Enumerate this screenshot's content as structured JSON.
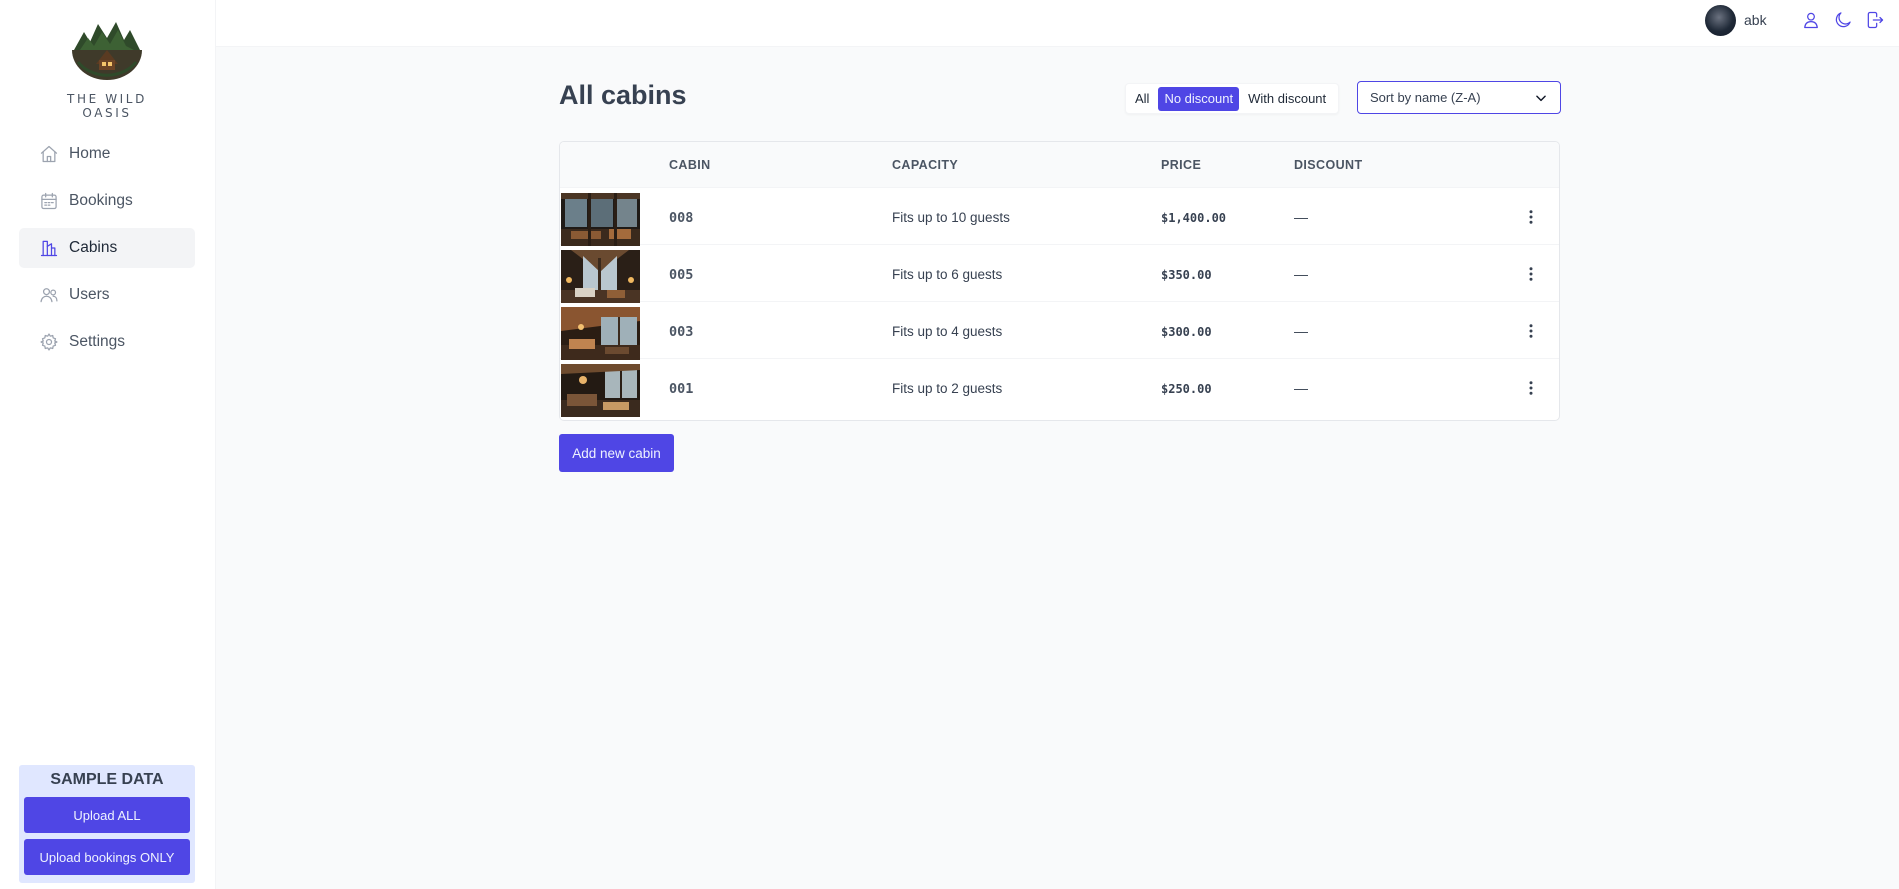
{
  "brand": {
    "name": "THE WILD OASIS"
  },
  "sidebar": {
    "items": [
      {
        "label": "Home",
        "icon": "home-icon",
        "active": false
      },
      {
        "label": "Bookings",
        "icon": "calendar-icon",
        "active": false
      },
      {
        "label": "Cabins",
        "icon": "cabins-icon",
        "active": true
      },
      {
        "label": "Users",
        "icon": "users-icon",
        "active": false
      },
      {
        "label": "Settings",
        "icon": "gear-icon",
        "active": false
      }
    ],
    "sample": {
      "title": "SAMPLE DATA",
      "upload_all": "Upload ALL",
      "upload_bookings": "Upload bookings ONLY"
    }
  },
  "header": {
    "username": "abk",
    "icons": [
      "user-icon",
      "moon-icon",
      "logout-icon"
    ]
  },
  "main": {
    "title": "All cabins",
    "filters": [
      {
        "label": "All",
        "active": false
      },
      {
        "label": "No discount",
        "active": true
      },
      {
        "label": "With discount",
        "active": false
      }
    ],
    "sort": {
      "selected": "Sort by name (Z-A)"
    },
    "table": {
      "columns": [
        "",
        "CABIN",
        "CAPACITY",
        "PRICE",
        "DISCOUNT",
        ""
      ],
      "rows": [
        {
          "name": "008",
          "capacity": "Fits up to 10 guests",
          "price": "$1,400.00",
          "discount": "—"
        },
        {
          "name": "005",
          "capacity": "Fits up to 6 guests",
          "price": "$350.00",
          "discount": "—"
        },
        {
          "name": "003",
          "capacity": "Fits up to 4 guests",
          "price": "$300.00",
          "discount": "—"
        },
        {
          "name": "001",
          "capacity": "Fits up to 2 guests",
          "price": "$250.00",
          "discount": "—"
        }
      ]
    },
    "add_button": "Add new cabin"
  },
  "colors": {
    "accent": "#4f46e5",
    "accent_light": "#e0e7ff",
    "background": "#f9fafb"
  }
}
